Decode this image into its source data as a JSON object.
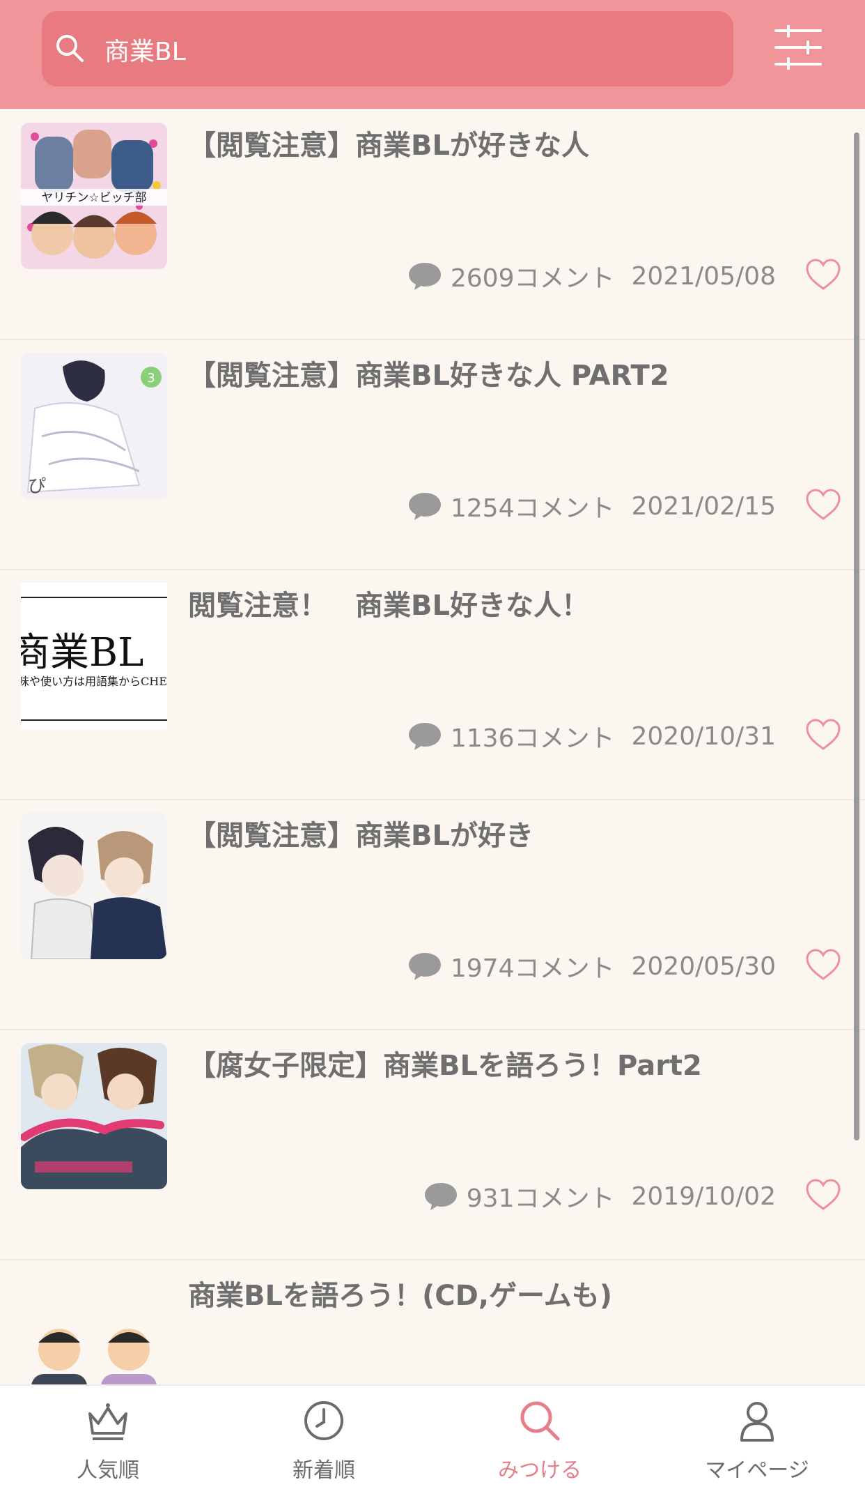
{
  "search": {
    "query": "商業BL"
  },
  "posts": [
    {
      "title": "【閲覧注意】商業BLが好きな人",
      "comments": "2609コメント",
      "date": "2021/05/08"
    },
    {
      "title": "【閲覧注意】商業BL好きな人 PART2",
      "comments": "1254コメント",
      "date": "2021/02/15"
    },
    {
      "title": "閲覧注意！　商業BL好きな人！",
      "comments": "1136コメント",
      "date": "2020/10/31",
      "thumb_text": "商業BL",
      "thumb_sub": "味や使い方は用語集からCHEC"
    },
    {
      "title": "【閲覧注意】商業BLが好き",
      "comments": "1974コメント",
      "date": "2020/05/30"
    },
    {
      "title": "【腐女子限定】商業BLを語ろう！Part2",
      "comments": "931コメント",
      "date": "2019/10/02"
    },
    {
      "title": "商業BLを語ろう！(CD,ゲームも)"
    }
  ],
  "tabs": [
    {
      "label": "人気順",
      "icon": "crown-icon"
    },
    {
      "label": "新着順",
      "icon": "clock-icon"
    },
    {
      "label": "みつける",
      "icon": "search-icon",
      "active": true
    },
    {
      "label": "マイページ",
      "icon": "user-icon"
    }
  ],
  "colors": {
    "header": "#f0959a",
    "search_bg": "#e87b80",
    "accent": "#e57f89",
    "background": "#fcf6f1"
  }
}
